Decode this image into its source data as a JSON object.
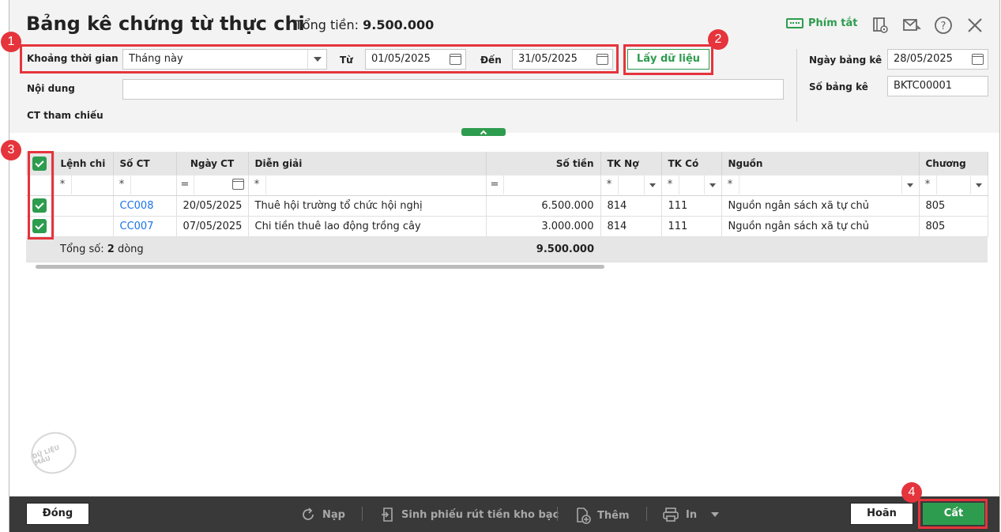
{
  "header": {
    "title": "Bảng kê chứng từ thực chi",
    "total_label": "Tổng tiền:",
    "total_value": "9.500.000",
    "shortcut_label": "Phím tắt",
    "icons": [
      "keyboard-icon",
      "view-icon",
      "mail-icon",
      "help-icon",
      "close-icon"
    ]
  },
  "filters": {
    "period_label": "Khoảng thời gian",
    "period_value": "Tháng này",
    "from_label": "Từ",
    "from_value": "01/05/2025",
    "to_label": "Đến",
    "to_value": "31/05/2025",
    "fetch_button": "Lấy dữ liệu",
    "content_label": "Nội dung",
    "content_value": "",
    "ref_label": "CT tham chiếu",
    "list_date_label": "Ngày bảng kê",
    "list_date_value": "28/05/2025",
    "list_no_label": "Số bảng kê",
    "list_no_value": "BKTC00001"
  },
  "badges": [
    "1",
    "2",
    "3",
    "4"
  ],
  "table": {
    "columns": [
      "Lệnh chi",
      "Số CT",
      "Ngày CT",
      "Diễn giải",
      "Số tiền",
      "TK Nợ",
      "TK Có",
      "Nguồn",
      "Chương"
    ],
    "filter_ops": [
      "*",
      "*",
      "=",
      "*",
      "=",
      "*",
      "*",
      "*",
      "*"
    ],
    "rows": [
      {
        "lenh_chi": "",
        "so_ct": "CC008",
        "ngay_ct": "20/05/2025",
        "dien_giai": "Thuê hội trường tổ chức hội nghị",
        "so_tien": "6.500.000",
        "tk_no": "814",
        "tk_co": "111",
        "nguon": "Nguồn ngân sách xã tự chủ",
        "chuong": "805"
      },
      {
        "lenh_chi": "",
        "so_ct": "CC007",
        "ngay_ct": "07/05/2025",
        "dien_giai": "Chi tiền thuê lao động trồng cây",
        "so_tien": "3.000.000",
        "tk_no": "814",
        "tk_co": "111",
        "nguon": "Nguồn ngân sách xã tự chủ",
        "chuong": "805"
      }
    ],
    "footer_label": "Tổng số:",
    "footer_count": "2",
    "footer_unit": "dòng",
    "footer_total": "9.500.000"
  },
  "stamp_text": "DỮ LIỆU MẪU",
  "footer": {
    "close": "Đóng",
    "reload": "Nạp",
    "generate": "Sinh phiếu rút tiền kho bạc",
    "add": "Thêm",
    "print": "In",
    "cancel": "Hoãn",
    "save": "Cất"
  },
  "colors": {
    "accent": "#2e9c4e",
    "highlight": "#e5343c",
    "footer_bg": "#393939",
    "link": "#1a73e8"
  }
}
